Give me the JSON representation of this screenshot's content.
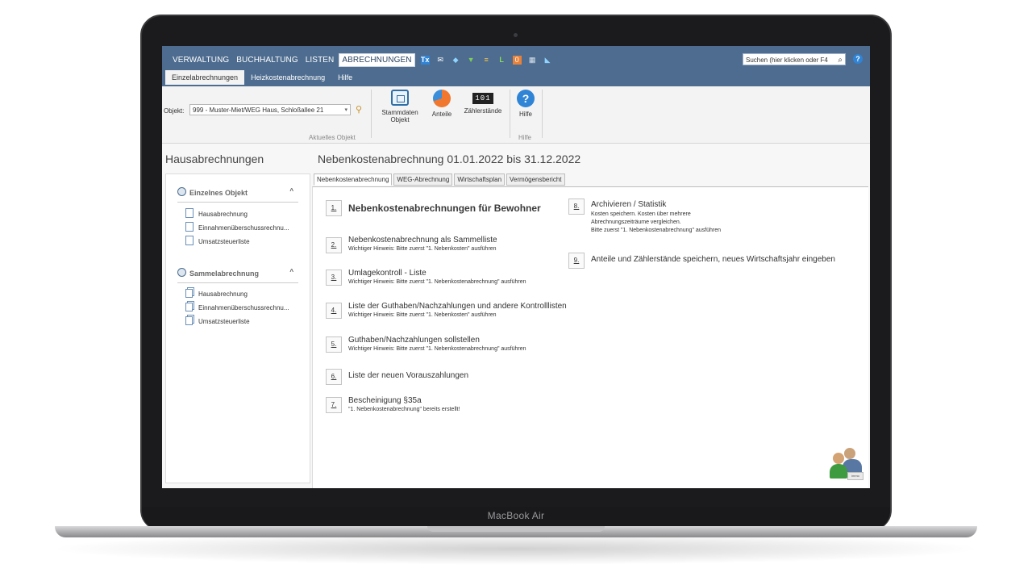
{
  "device": {
    "label": "MacBook Air"
  },
  "topbar": {
    "menu": [
      "VERWALTUNG",
      "BUCHHALTUNG",
      "LISTEN",
      "ABRECHNUNGEN"
    ],
    "active_menu": "ABRECHNUNGEN",
    "search_placeholder": "Suchen (hier klicken oder F4",
    "help_icon": "?"
  },
  "subtabs": [
    "Einzelabrechnungen",
    "Heizkostenabrechnung",
    "Hilfe"
  ],
  "ribbon": {
    "object_label": "Objekt:",
    "object_value": "999 - Muster-Miet/WEG Haus, Schloßallee 21",
    "group_current_object": "Aktuelles Objekt",
    "group_help": "Hilfe",
    "buttons": {
      "stammdaten": "Stammdaten Objekt",
      "anteile": "Anteile",
      "zaehlerstaende": "Zählerstände",
      "hilfe": "Hilfe"
    },
    "counter_display": "101"
  },
  "left": {
    "title": "Hausabrechnungen",
    "groups": [
      {
        "title": "Einzelnes Objekt",
        "items": [
          "Hausabrechnung",
          "Einnahmenüberschussrechnu...",
          "Umsatzsteuerliste"
        ]
      },
      {
        "title": "Sammelabrechnung",
        "items": [
          "Hausabrechnung",
          "Einnahmenüberschussrechnu...",
          "Umsatzsteuerliste"
        ]
      }
    ]
  },
  "main": {
    "title": "Nebenkostenabrechnung 01.01.2022 bis 31.12.2022",
    "tabs": [
      "Nebenkostenabrechnung",
      "WEG-Abrechnung",
      "Wirtschaftsplan",
      "Vermögensbericht"
    ],
    "steps": [
      {
        "num": "1.",
        "title": "Nebenkostenabrechnungen für Bewohner",
        "note": ""
      },
      {
        "num": "2.",
        "title": "Nebenkostenabrechnung als Sammelliste",
        "note": "Wichtiger Hinweis: Bitte zuerst \"1. Nebenkosten\" ausführen"
      },
      {
        "num": "3.",
        "title": "Umlagekontroll - Liste",
        "note": "Wichtiger Hinweis: Bitte zuerst \"1. Nebenkostenabrechnung\" ausführen"
      },
      {
        "num": "4.",
        "title": "Liste der Guthaben/Nachzahlungen und andere Kontrolllisten",
        "note": "Wichtiger Hinweis: Bitte zuerst \"1. Nebenkosten\" ausführen"
      },
      {
        "num": "5.",
        "title": "Guthaben/Nachzahlungen sollstellen",
        "note": "Wichtiger Hinweis: Bitte zuerst \"1. Nebenkostenabrechnung\" ausführen"
      },
      {
        "num": "6.",
        "title": "Liste der neuen Vorauszahlungen",
        "note": ""
      },
      {
        "num": "7.",
        "title": "Bescheinigung §35a",
        "note": "\"1. Nebenkostenabrechnung\" bereits erstellt!"
      },
      {
        "num": "8.",
        "title": "Archivieren / Statistik",
        "note_lines": [
          "Kosten speichern. Kosten über mehrere",
          "Abrechnungszeiträume vergleichen.",
          "Bitte zuerst \"1. Nebenkostenabrechnung\" ausführen"
        ]
      },
      {
        "num": "9.",
        "title": "Anteile und Zählerstände speichern, neues Wirtschaftsjahr eingeben",
        "note": ""
      }
    ],
    "avatar_badge": "immo"
  },
  "colors": {
    "topbar": "#4d6c8f",
    "accent": "#2f84d6"
  }
}
